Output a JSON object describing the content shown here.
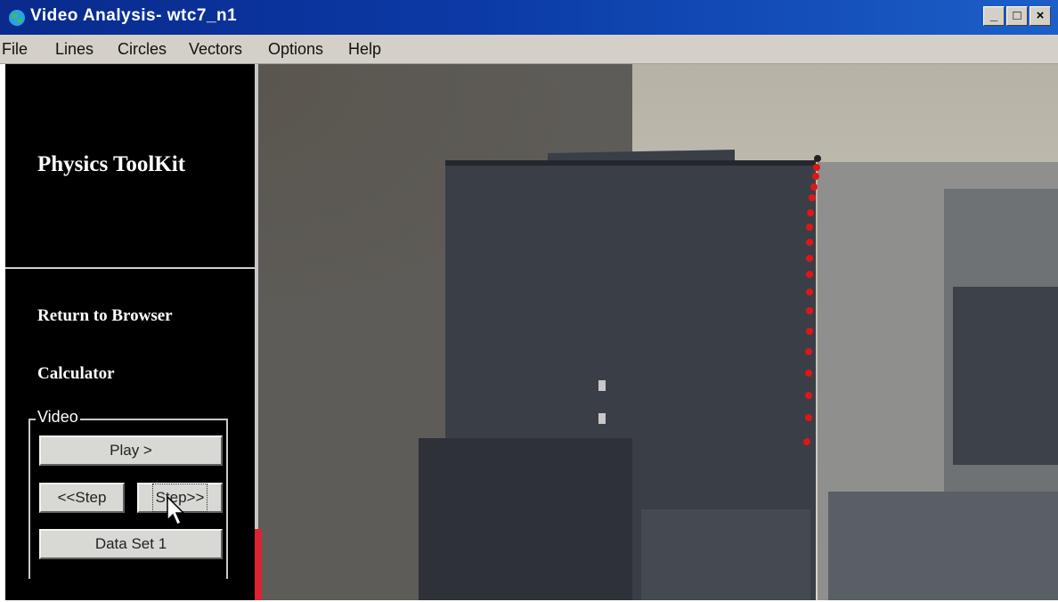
{
  "window": {
    "title": "Video Analysis- wtc7_n1",
    "controls": {
      "minimize": "_",
      "maximize": "□",
      "close": "×"
    }
  },
  "menu": [
    "File",
    "Lines",
    "Circles",
    "Vectors",
    "Options",
    "Help"
  ],
  "sidebar": {
    "brand": "Physics ToolKit",
    "links": {
      "return": "Return to Browser",
      "calculator": "Calculator"
    },
    "video_group": {
      "legend": "Video",
      "play": "Play >",
      "step_back": "<<Step",
      "step_forward": "Step>>",
      "data_set": "Data Set 1"
    }
  },
  "video": {
    "description_colors": {
      "sky": "#c9c6bd",
      "building": "#3a3f48",
      "smoke": "#8e8d88",
      "track": "#e01616"
    },
    "tracked_points": 18
  },
  "icons": {
    "app": "globe-icon",
    "cursor": "mouse-pointer-icon"
  }
}
